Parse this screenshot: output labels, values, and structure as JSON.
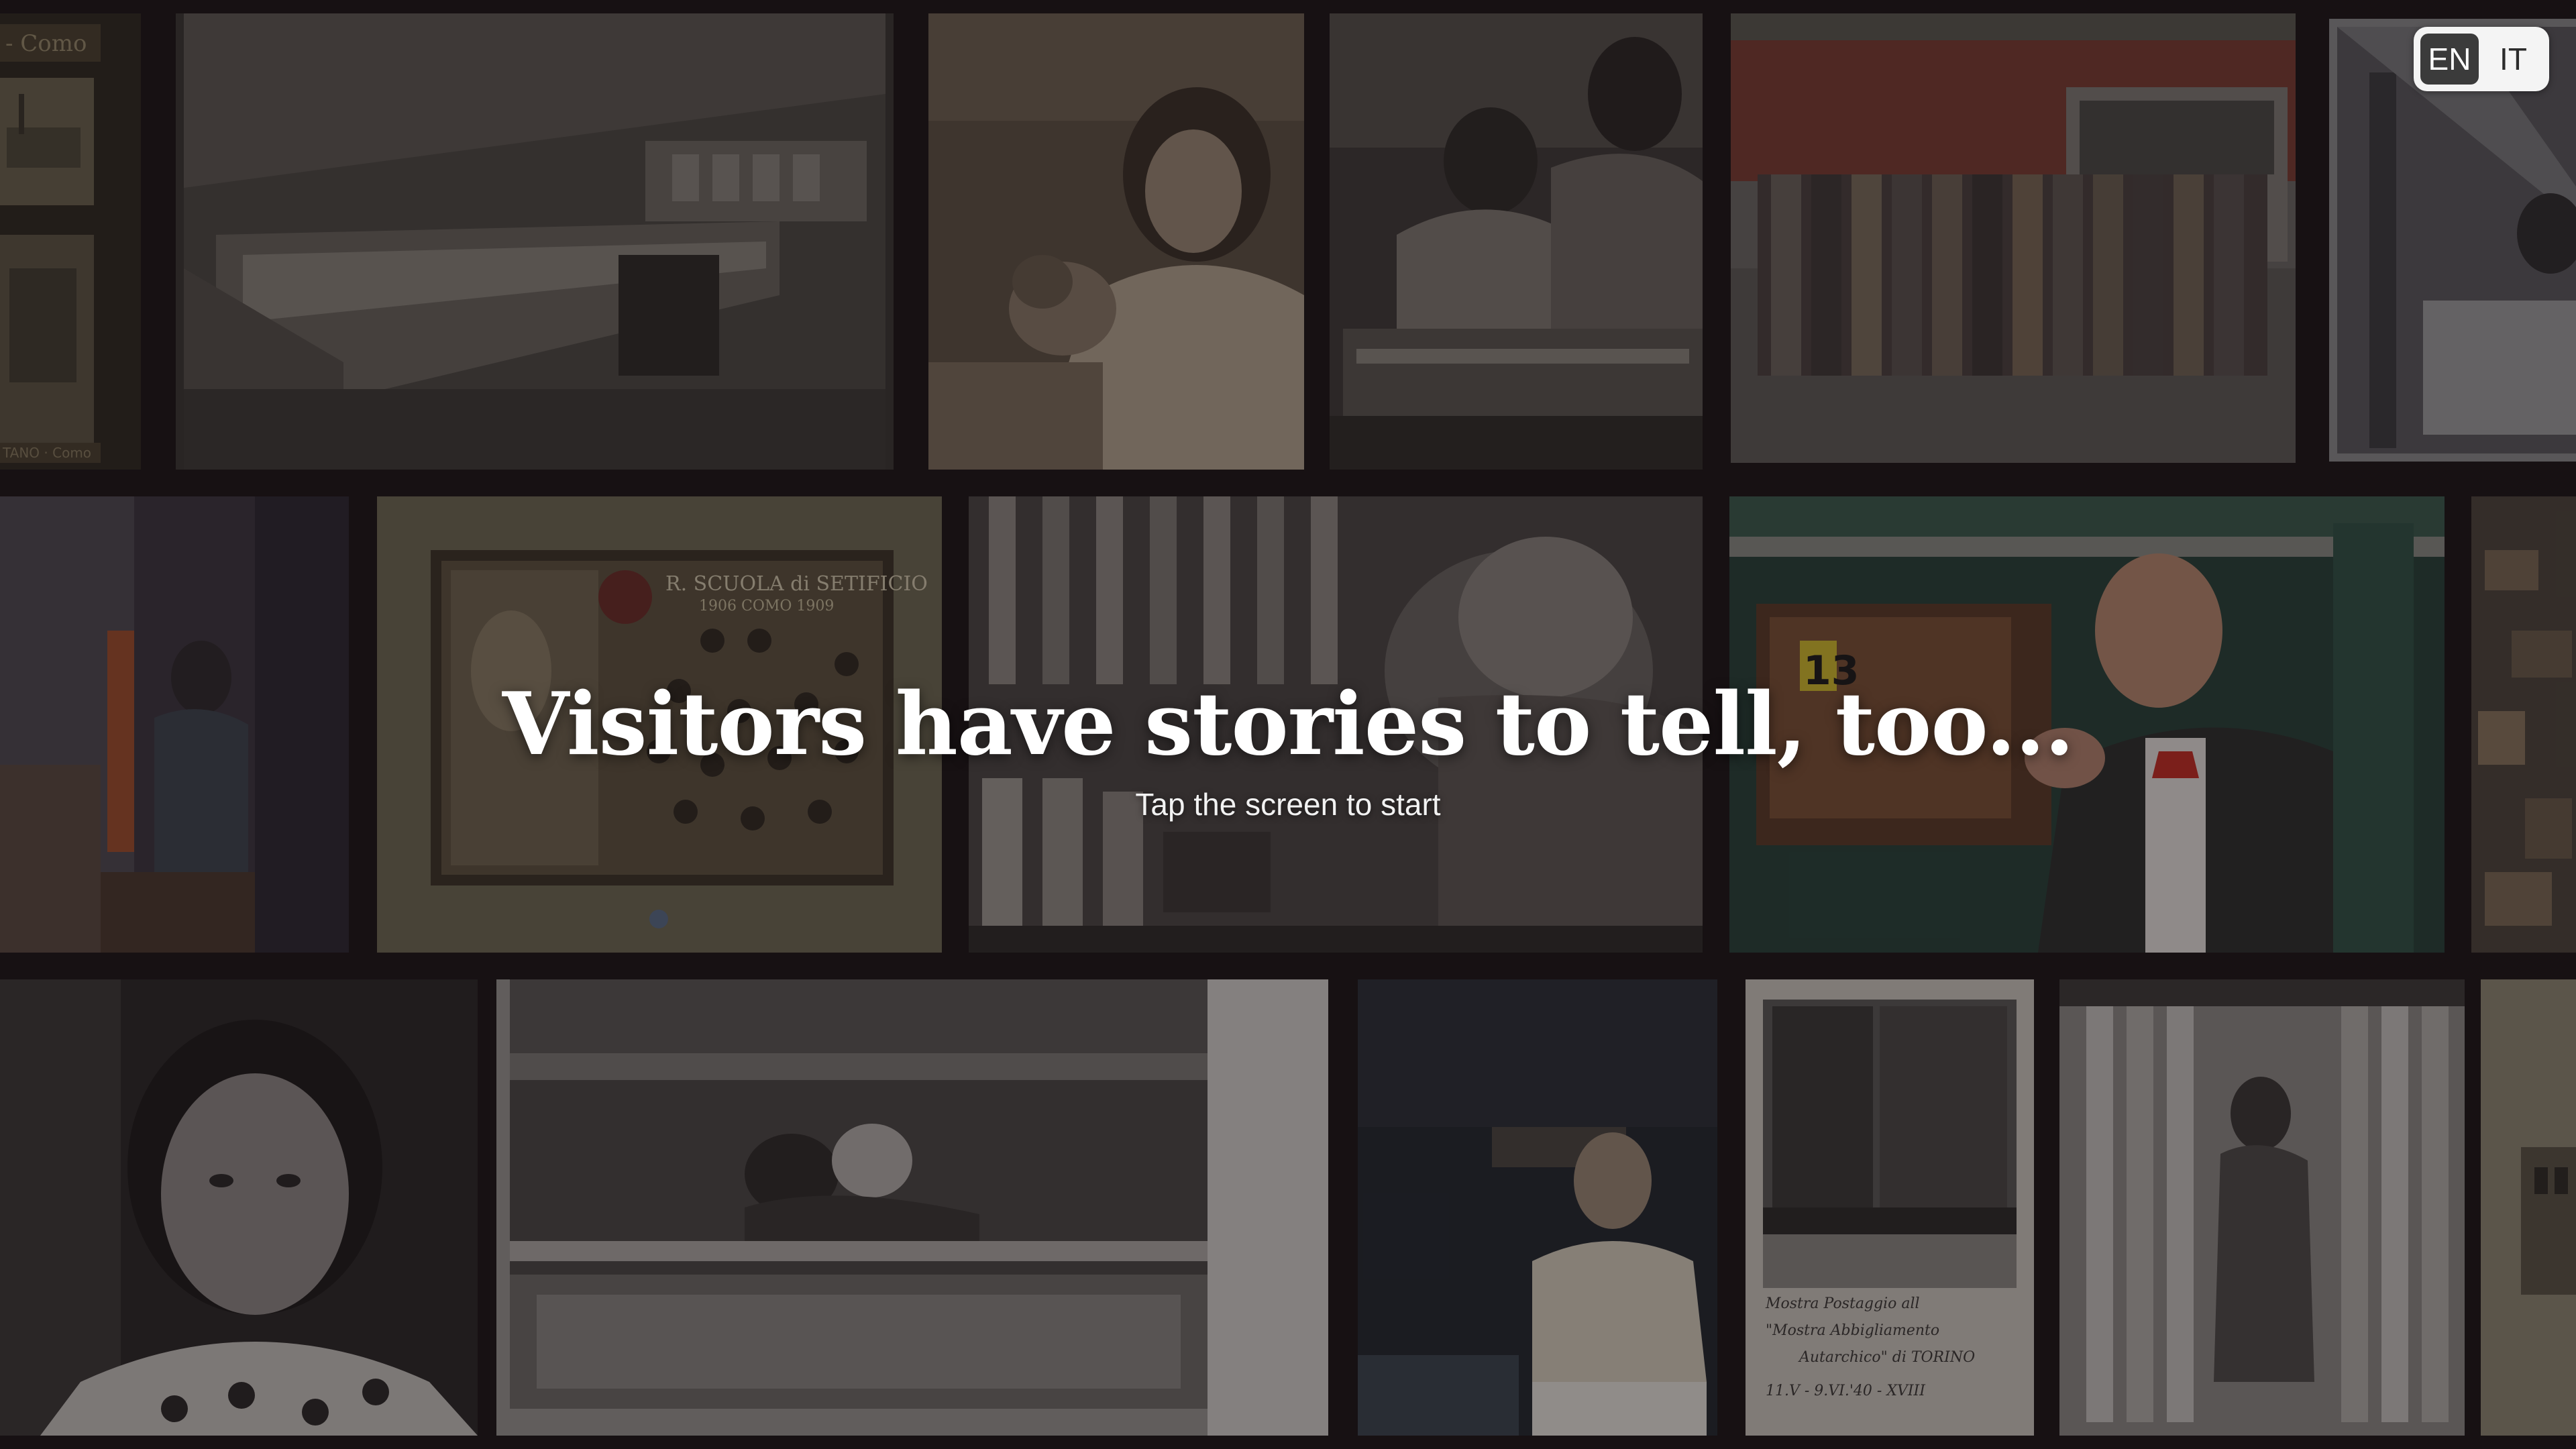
{
  "language_switch": {
    "options": [
      "EN",
      "IT"
    ],
    "selected": "EN"
  },
  "hero": {
    "title": "Visitors have stories to tell, too...",
    "subtitle": "Tap the screen to start"
  },
  "photos": {
    "postcard_caption_top": "- Como",
    "postcard_caption_bottom": "TANO · Como",
    "diploma_heading": "R. SCUOLA di SETIFICIO",
    "diploma_years": "1906  COMO  1909",
    "machine_number": "13",
    "handwritten_note_1": "Mostra Postaggio all",
    "handwritten_note_2": "\"Mostra Abbigliamento",
    "handwritten_note_3": "Autarchico\" di TORINO",
    "handwritten_note_4": "11.V - 9.VI.'40 - XVIII"
  },
  "colors": {
    "background": "#1a1517",
    "switch_active": "#3b3b3b",
    "switch_bg": "#f4f4f4",
    "title": "#ffffff"
  }
}
